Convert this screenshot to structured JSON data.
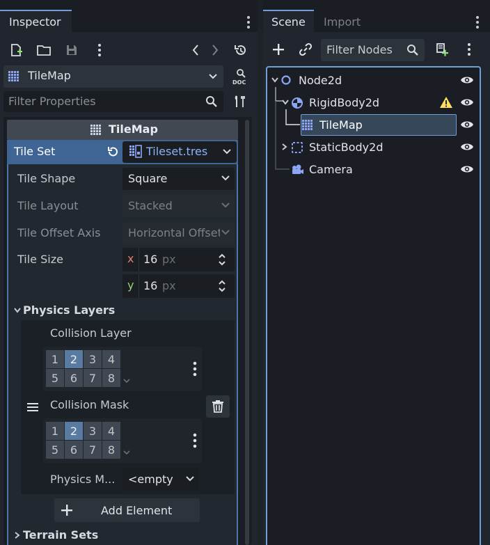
{
  "inspector": {
    "tab_label": "Inspector",
    "object_name": "TileMap",
    "filter_placeholder": "Filter Properties",
    "section_title": "TileMap",
    "tile_set": {
      "label": "Tile Set",
      "value": "Tileset.tres"
    },
    "properties": {
      "tile_shape": {
        "label": "Tile Shape",
        "value": "Square"
      },
      "tile_layout": {
        "label": "Tile Layout",
        "value": "Stacked"
      },
      "tile_offset_axis": {
        "label": "Tile Offset Axis",
        "value": "Horizontal Offset"
      },
      "tile_size": {
        "label": "Tile Size",
        "x_label": "x",
        "x_value": "16",
        "y_label": "y",
        "y_value": "16",
        "unit": "px"
      }
    },
    "physics_layers": {
      "title": "Physics Layers",
      "collision_layer": {
        "label": "Collision Layer",
        "cells": [
          "1",
          "2",
          "3",
          "4",
          "5",
          "6",
          "7",
          "8"
        ],
        "active": [
          "2"
        ]
      },
      "collision_mask": {
        "label": "Collision Mask",
        "cells": [
          "1",
          "2",
          "3",
          "4",
          "5",
          "6",
          "7",
          "8"
        ],
        "active": [
          "2"
        ]
      },
      "physics_material": {
        "label": "Physics M...",
        "value": "<empty"
      },
      "add_element_label": "Add Element"
    },
    "terrain_sets_title": "Terrain Sets"
  },
  "scene": {
    "tabs": [
      "Scene",
      "Import"
    ],
    "active_tab": "Scene",
    "filter_placeholder": "Filter Nodes",
    "tree": [
      {
        "name": "Node2d",
        "icon": "node2d-circle-icon",
        "warning": false,
        "selected": false
      },
      {
        "name": "RigidBody2d",
        "icon": "rigidbody-icon",
        "warning": true,
        "selected": false
      },
      {
        "name": "TileMap",
        "icon": "tilemap-grid-icon",
        "warning": false,
        "selected": true
      },
      {
        "name": "StaticBody2d",
        "icon": "staticbody-icon",
        "warning": false,
        "selected": false
      },
      {
        "name": "Camera",
        "icon": "camera-icon",
        "warning": false,
        "selected": false
      }
    ]
  },
  "colors": {
    "background": "#1d2229",
    "panel": "#21262e",
    "accent": "#6f9fd8",
    "selected_row": "#37475a",
    "warning": "#ffdd65",
    "x_axis": "#e2826c",
    "y_axis": "#96d277"
  }
}
